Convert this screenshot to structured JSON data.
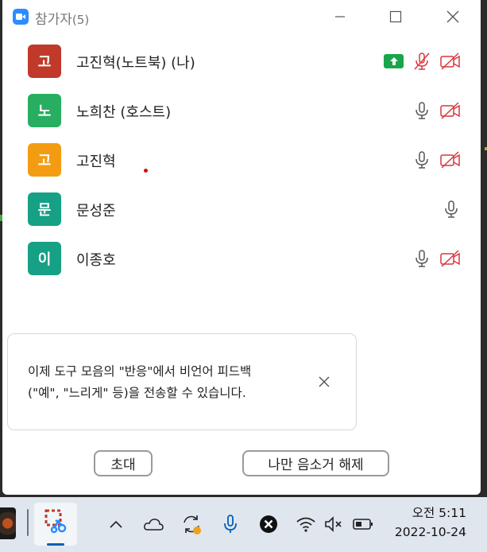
{
  "window": {
    "title": "참가자",
    "count": "(5)",
    "controls": {
      "minimize": "minimize",
      "maximize": "maximize",
      "close": "close"
    }
  },
  "participants": [
    {
      "initial": "고",
      "name": "고진혁(노트북) (나)",
      "avatar_color": "#c0392b",
      "sharing": true,
      "mic": "muted",
      "video": "off"
    },
    {
      "initial": "노",
      "name": "노희찬 (호스트)",
      "avatar_color": "#27ae60",
      "sharing": false,
      "mic": "on",
      "video": "off"
    },
    {
      "initial": "고",
      "name": "고진혁",
      "avatar_color": "#f39c12",
      "sharing": false,
      "mic": "on",
      "video": "off"
    },
    {
      "initial": "문",
      "name": "문성준",
      "avatar_color": "#16a085",
      "sharing": false,
      "mic": "on",
      "video": "none"
    },
    {
      "initial": "이",
      "name": "이종호",
      "avatar_color": "#16a085",
      "sharing": false,
      "mic": "on",
      "video": "off"
    }
  ],
  "notice": {
    "line1": "이제 도구 모음의 \"반응\"에서 비언어 피드백",
    "line2": "(\"예\", \"느리게\" 등)을 전송할 수 있습니다."
  },
  "footer": {
    "invite_label": "초대",
    "unmute_label": "나만 음소거 해제"
  },
  "taskbar": {
    "time": "오전 5:11",
    "date": "2022-10-24",
    "tray_icons": [
      "chevron-up-icon",
      "onedrive-cloud-icon",
      "sync-icon",
      "microphone-icon",
      "x-circle-icon",
      "wifi-icon",
      "speaker-muted-icon",
      "battery-icon"
    ]
  },
  "colors": {
    "muted_red": "#d9363e",
    "share_green": "#19a54c",
    "zoom_blue": "#2d8cff"
  }
}
